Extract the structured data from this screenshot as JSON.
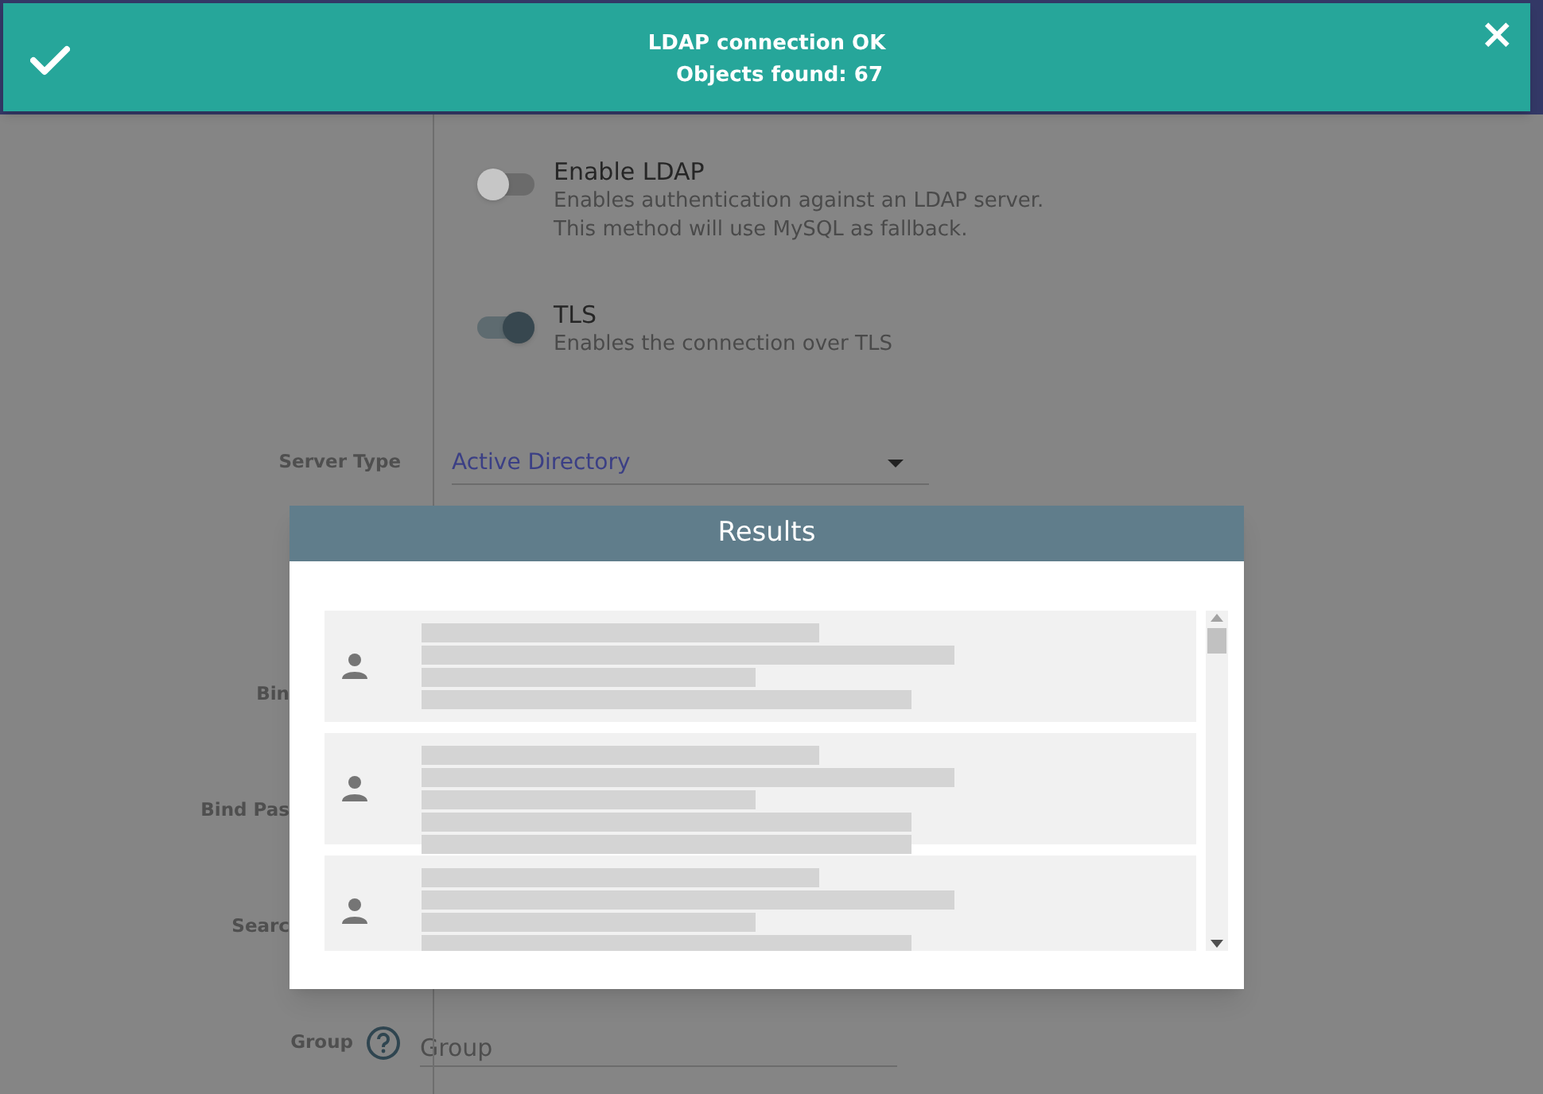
{
  "toast": {
    "title": "LDAP connection OK",
    "message": "Objects found: 67",
    "close": "×"
  },
  "toggles": [
    {
      "label": "Enable LDAP",
      "description": [
        "Enables authentication against an LDAP server.",
        "This method will use MySQL as fallback."
      ],
      "on": false
    },
    {
      "label": "TLS",
      "description": [
        "Enables the connection over TLS"
      ],
      "on": true
    }
  ],
  "fields": [
    {
      "label": "Server Type",
      "kind": "select",
      "value": "Active Directory"
    },
    {
      "label": "Bin",
      "kind": "covered"
    },
    {
      "label": "Bind Pas",
      "kind": "covered"
    },
    {
      "label": "Searc",
      "kind": "covered"
    },
    {
      "label": "Group",
      "kind": "input",
      "placeholder": "Group",
      "help": true
    }
  ],
  "results_dialog": {
    "title": "Results",
    "items": [
      {
        "kind": "redacted"
      },
      {
        "kind": "redacted"
      },
      {
        "kind": "redacted"
      }
    ]
  }
}
